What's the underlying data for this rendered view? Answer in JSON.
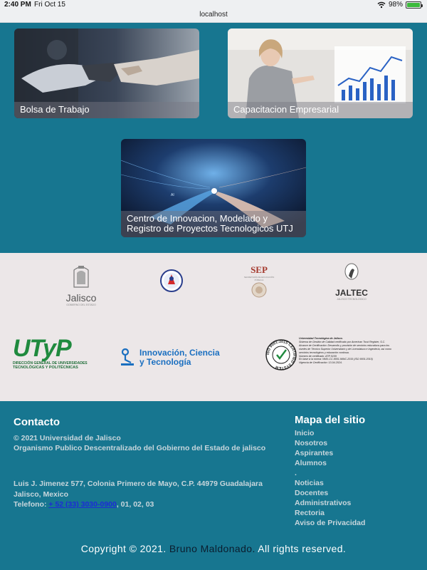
{
  "status_bar": {
    "time": "2:40 PM",
    "date": "Fri Oct 15",
    "url": "localhost",
    "battery": "98%",
    "battery_level": 0.98
  },
  "cards": [
    {
      "label": "Bolsa de Trabajo",
      "image": "robot-handshake"
    },
    {
      "label": "Capacitacion Empresarial",
      "image": "business-woman-chart"
    },
    {
      "label": "Centro de Innovacion, Modelado y Registro de Proyectos Tecnologicos UTJ",
      "image": "ai-hands"
    }
  ],
  "logos": {
    "jalisco": {
      "name": "Jalisco",
      "sub": "GOBIERNO DEL ESTADO"
    },
    "sep": {
      "name": "SEP",
      "sub": "SECRETARÍA DE EDUCACIÓN PÚBLICA"
    },
    "jaltec": {
      "name": "JALTEC",
      "sub": "JALISCO TECNOLÓGICO"
    },
    "utyp": {
      "name": "UTyP",
      "sub1": "DIRECCIÓN GENERAL DE UNIVERSIDADES",
      "sub2": "TECNOLÓGICAS Y POLITÉCNICAS"
    },
    "innovacion": {
      "line1": "Innovación, Ciencia",
      "line2": "y Tecnología"
    },
    "iso": {
      "ring": "ISO 9001:2015 CERTIFIED SYSTEM",
      "text": [
        "Universidad Tecnológica de Jalisco.",
        "Sistema de Gestión de Calidad certificado por American Trust Register, S.C.",
        "Alcance de Certificación: Desarrollo y provisión de servicios educativos para los",
        "niveles de Técnico Superior Universitario y de Licenciatura e Ingeniería, así como",
        "servicios tecnológicos y educación continua.",
        "Número de certificado: ATR 5109",
        "En base a la norma: NMX-CC-9001-IMNC-2015 (ISO 9001:2015)",
        "Vigencia de Certificación: 13-04-2024."
      ]
    }
  },
  "footer": {
    "contact_title": "Contacto",
    "copyright_line": "© 2021 Universidad de Jalisco",
    "org_line": "Organismo Publico Descentralizado del Gobierno del Estado de jalisco",
    "address_line1": "Luis J. Jimenez 577, Colonia Primero de Mayo, C.P. 44979 Guadalajara",
    "address_line2": "Jalisco, Mexico",
    "phone_label": "Telefono:",
    "phone_number": "+ 52 (33) 3030-0900",
    "phone_ext": ", 01, 02, 03",
    "sitemap_title": "Mapa del sitio",
    "sitemap_items": [
      "Inicio",
      "Nosotros",
      "Aspirantes",
      "Alumnos",
      ".",
      "Noticias",
      "Docentes",
      "Administrativos",
      "Rectoria",
      "Aviso de Privacidad"
    ],
    "bottom_prefix": "Copyright © 2021. ",
    "bottom_author": "Bruno Maldonado.",
    "bottom_suffix": " All rights reserved."
  },
  "colors": {
    "background": "#177690",
    "logo_band": "#ece7e8",
    "link": "#1d2bd6"
  }
}
